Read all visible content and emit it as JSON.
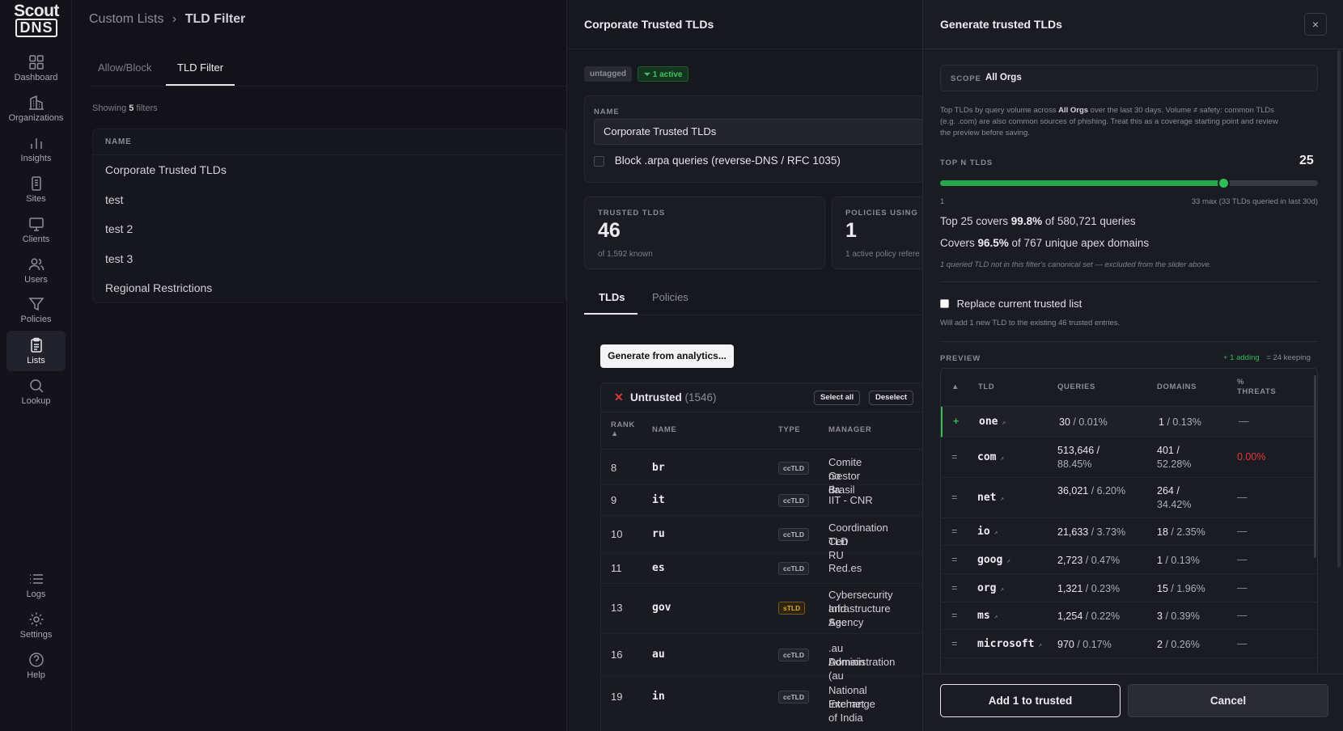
{
  "brand": {
    "line1": "Scout",
    "line2": "DNS"
  },
  "sidebar": {
    "items": [
      {
        "label": "Dashboard",
        "icon": "grid-icon"
      },
      {
        "label": "Organizations",
        "icon": "building-icon"
      },
      {
        "label": "Insights",
        "icon": "bar-chart-icon"
      },
      {
        "label": "Sites",
        "icon": "site-icon"
      },
      {
        "label": "Clients",
        "icon": "monitor-icon"
      },
      {
        "label": "Users",
        "icon": "users-icon"
      },
      {
        "label": "Policies",
        "icon": "filter-icon"
      },
      {
        "label": "Lists",
        "icon": "clipboard-icon"
      },
      {
        "label": "Lookup",
        "icon": "search-icon"
      },
      {
        "label": "Logs",
        "icon": "list-icon"
      },
      {
        "label": "Settings",
        "icon": "gear-icon"
      },
      {
        "label": "Help",
        "icon": "help-icon"
      }
    ],
    "active": "Lists"
  },
  "breadcrumb": {
    "parent": "Custom Lists",
    "sep": "›",
    "current": "TLD Filter"
  },
  "main": {
    "tabs": [
      {
        "label": "Allow/Block"
      },
      {
        "label": "TLD Filter"
      }
    ],
    "showing": {
      "prefix": "Showing",
      "count": "5",
      "suffix": "filters"
    },
    "table_header": "NAME",
    "filters": [
      "Corporate Trusted TLDs",
      "test",
      "test 2",
      "test 3",
      "Regional Restrictions"
    ]
  },
  "detail": {
    "title": "Corporate Trusted TLDs",
    "chip_untagged": "untagged",
    "chip_active": "1 active",
    "name_label": "NAME",
    "name_value": "Corporate Trusted TLDs",
    "arpa_label": "Block .arpa queries (reverse-DNS / RFC 1035)",
    "stat_trusted": {
      "label": "TRUSTED TLDS",
      "value": "46",
      "sub": "of 1,592 known"
    },
    "stat_policies": {
      "label": "POLICIES USING",
      "value": "1",
      "sub": "1 active policy refere"
    },
    "tabs": [
      {
        "label": "TLDs"
      },
      {
        "label": "Policies"
      }
    ],
    "generate_button": "Generate from analytics...",
    "untrusted": {
      "title": "Untrusted",
      "count": "(1546)",
      "select_all": "Select all",
      "deselect": "Deselect",
      "cols": {
        "rank": "RANK",
        "name": "NAME",
        "type": "TYPE",
        "manager": "MANAGER"
      },
      "rows": [
        {
          "rank": "8",
          "name": "br",
          "type": "ccTLD",
          "manager": "Comite Gestor da",
          "manager2": "no Brasil"
        },
        {
          "rank": "9",
          "name": "it",
          "type": "ccTLD",
          "manager": "IIT - CNR",
          "manager2": ""
        },
        {
          "rank": "10",
          "name": "ru",
          "type": "ccTLD",
          "manager": "Coordination Cen",
          "manager2": "TLD RU"
        },
        {
          "rank": "11",
          "name": "es",
          "type": "ccTLD",
          "manager": "Red.es",
          "manager2": ""
        },
        {
          "rank": "13",
          "name": "gov",
          "type": "sTLD",
          "manager": "Cybersecurity and",
          "manager2": "Infrastructure Sec",
          "manager3": "Agency"
        },
        {
          "rank": "16",
          "name": "au",
          "type": "ccTLD",
          "manager": ".au Domain",
          "manager2": "Administration (au"
        },
        {
          "rank": "19",
          "name": "in",
          "type": "ccTLD",
          "manager": "National Internet",
          "manager2": "Exchange of India"
        }
      ]
    }
  },
  "generate": {
    "title": "Generate trusted TLDs",
    "close": "×",
    "scope_label": "SCOPE",
    "scope_value": "All Orgs",
    "desc_1": "Top TLDs by query volume across ",
    "desc_bold": "All Orgs",
    "desc_2": " over the last 30 days. Volume ≠ safety: common TLDs",
    "desc_3": "(e.g. .com) are also common sources of phishing. Treat this as a coverage starting point and review",
    "desc_4": "the preview before saving.",
    "topn_label": "TOP N TLDS",
    "topn_value": "25",
    "slider": {
      "min": 1,
      "max": 33,
      "value": 25
    },
    "min_label": "1",
    "max_label": "33 max (33 TLDs queried in last 30d)",
    "covers1": {
      "a": "Top 25 covers ",
      "pct": "99.8%",
      "b": " of 580,721 queries"
    },
    "covers2": {
      "a": "Covers ",
      "pct": "96.5%",
      "b": " of 767 unique apex domains"
    },
    "note": "1 queried TLD not in this filter's canonical set — excluded from the slider above.",
    "replace_label": "Replace current trusted list",
    "will_add": "Will add 1 new TLD to the existing 46 trusted entries.",
    "preview_label": "PREVIEW",
    "adding": "+ 1 adding",
    "keeping": "= 24 keeping",
    "cols": {
      "sort": "▲",
      "tld": "TLD",
      "queries": "QUERIES",
      "domains": "DOMAINS",
      "threats1": "%",
      "threats2": "THREATS"
    },
    "rows": [
      {
        "sym": "+",
        "tld": "one",
        "q1": "30",
        "q2": "/ 0.01%",
        "q1b": "",
        "d1": "1",
        "d2": "/ 0.13%",
        "d1b": "",
        "thr": "—"
      },
      {
        "sym": "=",
        "tld": "com",
        "q1": "513,646 /",
        "q2": "",
        "q1b": "88.45%",
        "d1": "401 /",
        "d2": "",
        "d1b": "52.28%",
        "thr": "0.00%"
      },
      {
        "sym": "=",
        "tld": "net",
        "q1": "36,021",
        "q2": "/ 6.20%",
        "q1b": "",
        "d1": "264 /",
        "d2": "",
        "d1b": "34.42%",
        "thr": "—"
      },
      {
        "sym": "=",
        "tld": "io",
        "q1": "21,633",
        "q2": "/ 3.73%",
        "q1b": "",
        "d1": "18",
        "d2": "/ 2.35%",
        "d1b": "",
        "thr": "—"
      },
      {
        "sym": "=",
        "tld": "goog",
        "q1": "2,723",
        "q2": "/ 0.47%",
        "q1b": "",
        "d1": "1",
        "d2": "/ 0.13%",
        "d1b": "",
        "thr": "—"
      },
      {
        "sym": "=",
        "tld": "org",
        "q1": "1,321",
        "q2": "/ 0.23%",
        "q1b": "",
        "d1": "15",
        "d2": "/ 1.96%",
        "d1b": "",
        "thr": "—"
      },
      {
        "sym": "=",
        "tld": "ms",
        "q1": "1,254",
        "q2": "/ 0.22%",
        "q1b": "",
        "d1": "3",
        "d2": "/ 0.39%",
        "d1b": "",
        "thr": "—"
      },
      {
        "sym": "=",
        "tld": "microsoft",
        "q1": "970",
        "q2": "/ 0.17%",
        "q1b": "",
        "d1": "2",
        "d2": "/ 0.26%",
        "d1b": "",
        "thr": "—"
      }
    ],
    "add_button": "Add 1 to trusted",
    "cancel_button": "Cancel"
  },
  "colors": {
    "accent_green": "#2fbd55",
    "danger": "#e23b3b",
    "stld_badge": "#e0a924"
  }
}
